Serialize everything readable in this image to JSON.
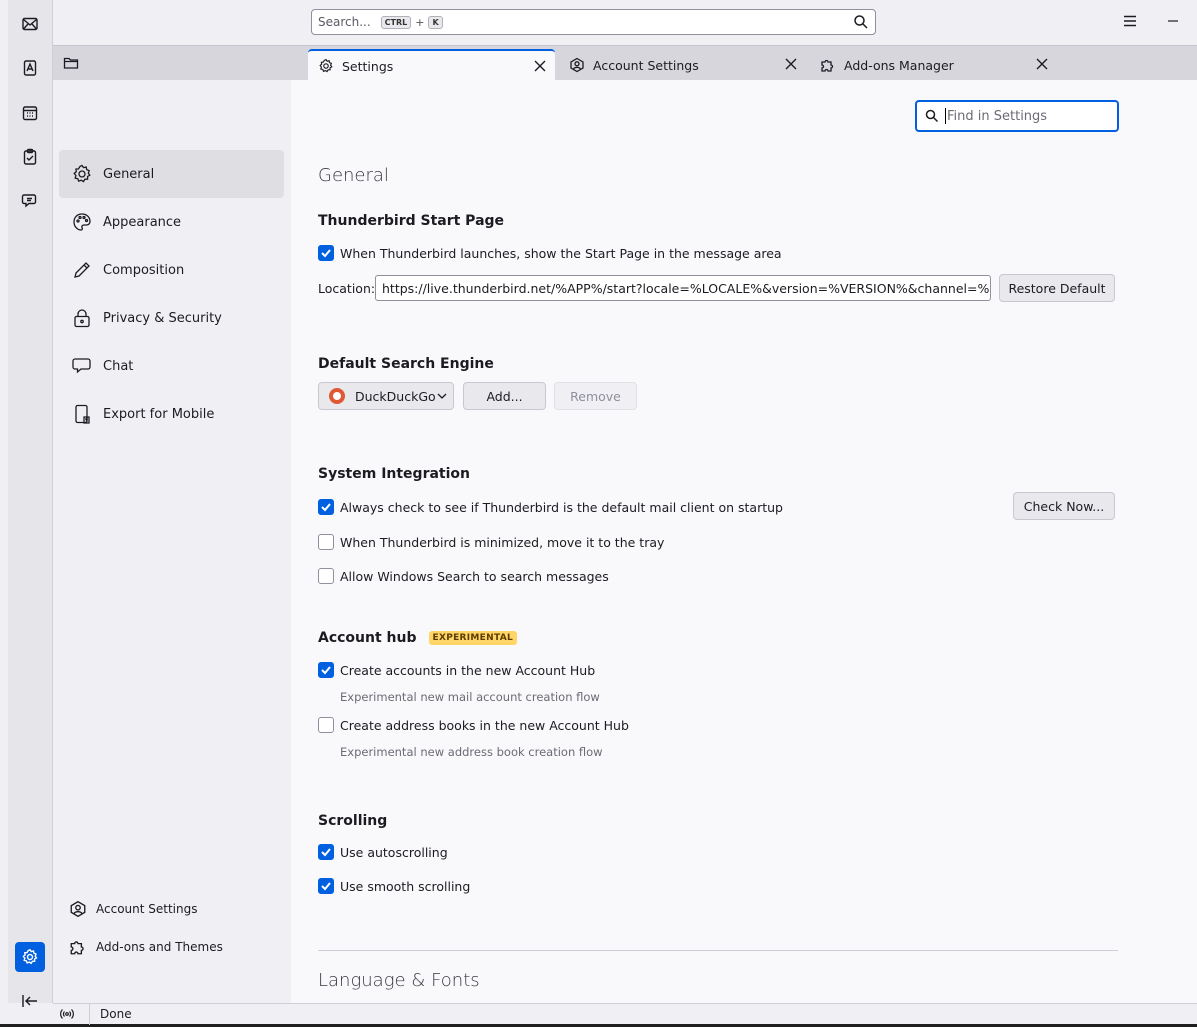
{
  "toolbar": {
    "search_placeholder": "Search...",
    "search_shortcut_key1": "CTRL",
    "search_shortcut_plus": "+",
    "search_shortcut_key2": "K"
  },
  "tabs": [
    {
      "label": "Settings",
      "icon": "gear-icon",
      "selected": true
    },
    {
      "label": "Account Settings",
      "icon": "account-icon",
      "selected": false
    },
    {
      "label": "Add-ons Manager",
      "icon": "puzzle-icon",
      "selected": false
    }
  ],
  "sidebar": {
    "categories": [
      {
        "label": "General",
        "icon": "gear-icon",
        "active": true
      },
      {
        "label": "Appearance",
        "icon": "palette-icon"
      },
      {
        "label": "Composition",
        "icon": "pencil-icon"
      },
      {
        "label": "Privacy & Security",
        "icon": "lock-icon"
      },
      {
        "label": "Chat",
        "icon": "chat-icon"
      },
      {
        "label": "Export for Mobile",
        "icon": "mobile-export-icon"
      }
    ],
    "footer_links": [
      {
        "label": "Account Settings",
        "icon": "account-icon"
      },
      {
        "label": "Add-ons and Themes",
        "icon": "puzzle-icon"
      }
    ]
  },
  "content": {
    "find_placeholder": "Find in Settings",
    "page_title": "General",
    "start_page": {
      "heading": "Thunderbird Start Page",
      "show_start_page": {
        "label": "When Thunderbird launches, show the Start Page in the message area",
        "checked": true
      },
      "location_label": "Location:",
      "location_value": "https://live.thunderbird.net/%APP%/start?locale=%LOCALE%&version=%VERSION%&channel=%CHAN",
      "restore_default": "Restore Default"
    },
    "search_engine": {
      "heading": "Default Search Engine",
      "selected": "DuckDuckGo",
      "add_button": "Add...",
      "remove_button": "Remove"
    },
    "system_integration": {
      "heading": "System Integration",
      "default_client": {
        "label": "Always check to see if Thunderbird is the default mail client on startup",
        "checked": true
      },
      "check_now": "Check Now...",
      "minimize_tray": {
        "label": "When Thunderbird is minimized, move it to the tray",
        "checked": false
      },
      "windows_search": {
        "label": "Allow Windows Search to search messages",
        "checked": false
      }
    },
    "account_hub": {
      "heading": "Account hub",
      "badge": "EXPERIMENTAL",
      "create_accounts": {
        "label": "Create accounts in the new Account Hub",
        "checked": true
      },
      "create_accounts_desc": "Experimental new mail account creation flow",
      "create_address_books": {
        "label": "Create address books in the new Account Hub",
        "checked": false
      },
      "create_address_books_desc": "Experimental new address book creation flow"
    },
    "scrolling": {
      "heading": "Scrolling",
      "autoscroll": {
        "label": "Use autoscrolling",
        "checked": true
      },
      "smooth": {
        "label": "Use smooth scrolling",
        "checked": true
      }
    },
    "language_fonts_title": "Language & Fonts"
  },
  "statusbar": {
    "text": "Done"
  },
  "colors": {
    "accent": "#0060df",
    "badge": "#ffd567"
  }
}
